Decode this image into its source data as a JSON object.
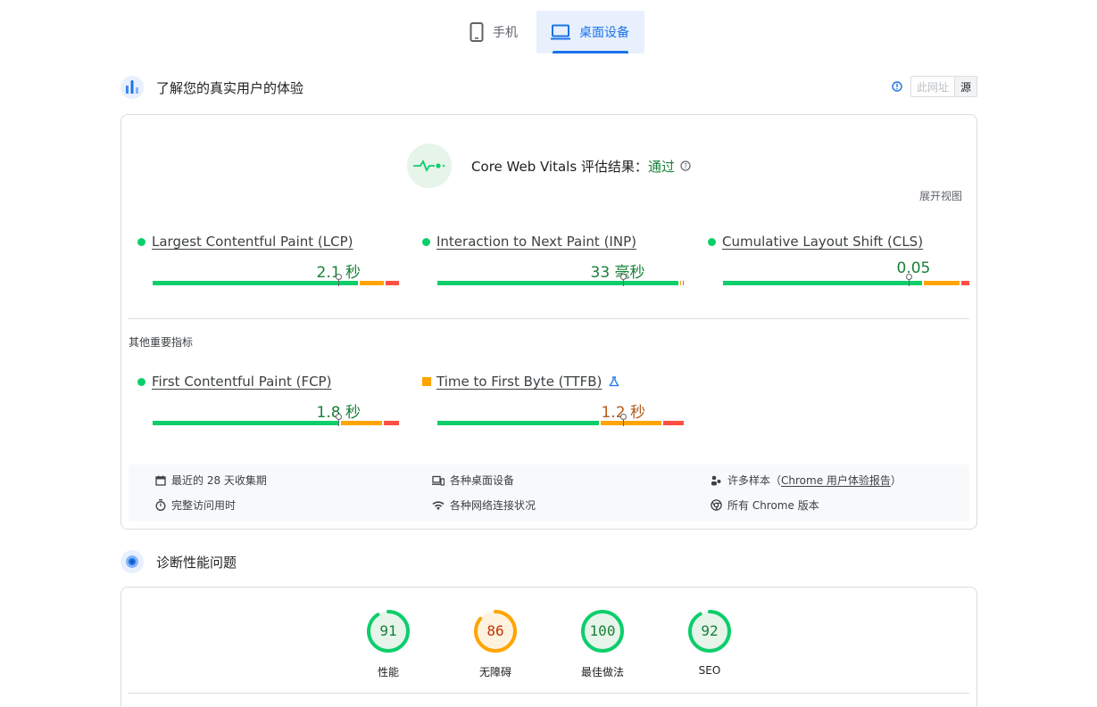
{
  "tabs": [
    {
      "label": "手机",
      "active": false
    },
    {
      "label": "桌面设备",
      "active": true
    }
  ],
  "section_real_users": {
    "title": "了解您的真实用户的体验",
    "toggle_url": "此网址",
    "toggle_origin": "源"
  },
  "cwv": {
    "title_prefix": "Core Web Vitals 评估结果：",
    "result": "通过",
    "expand_view": "展开视图"
  },
  "metrics": [
    {
      "name": "Largest Contentful Paint (LCP)",
      "value": "2.1 秒",
      "status": "good",
      "marker_fraction": 0.75,
      "dist": [
        0.835,
        0.105,
        0.06
      ]
    },
    {
      "name": "Interaction to Next Paint (INP)",
      "value": "33 毫秒",
      "status": "good",
      "marker_fraction": 0.75,
      "dist": [
        0.98,
        0.01,
        0.01
      ]
    },
    {
      "name": "Cumulative Layout Shift (CLS)",
      "value": "0.05",
      "status": "good",
      "marker_fraction": 0.75,
      "dist": [
        0.81,
        0.15,
        0.04
      ]
    }
  ],
  "other_metrics_label": "其他重要指标",
  "other_metrics": [
    {
      "name": "First Contentful Paint (FCP)",
      "value": "1.8 秒",
      "status": "good",
      "marker_fraction": 0.75,
      "dist": [
        0.76,
        0.17,
        0.07
      ]
    },
    {
      "name": "Time to First Byte (TTFB)",
      "value": "1.2 秒",
      "status": "average",
      "marker_fraction": 0.75,
      "dist": [
        0.66,
        0.25,
        0.09
      ]
    }
  ],
  "footer": {
    "period": "最近的 28 天收集期",
    "devices": "各种桌面设备",
    "samples_prefix": "许多样本（",
    "samples_link": "Chrome 用户体验报告",
    "samples_suffix": "）",
    "visit": "完整访问用时",
    "network": "各种网络连接状况",
    "chrome": "所有 Chrome 版本"
  },
  "section_diagnose": {
    "title": "诊断性能问题"
  },
  "scores": [
    {
      "label": "性能",
      "value": "91",
      "fraction": 0.91,
      "status": "good"
    },
    {
      "label": "无障碍",
      "value": "86",
      "fraction": 0.86,
      "status": "average"
    },
    {
      "label": "最佳做法",
      "value": "100",
      "fraction": 1.0,
      "status": "good"
    },
    {
      "label": "SEO",
      "value": "92",
      "fraction": 0.92,
      "status": "good"
    }
  ],
  "colors": {
    "good": "#0cce6b",
    "average": "#ffa400",
    "poor": "#ff4e42",
    "good_text": "#188038",
    "average_text": "#b3591a",
    "accent": "#1a73e8"
  }
}
